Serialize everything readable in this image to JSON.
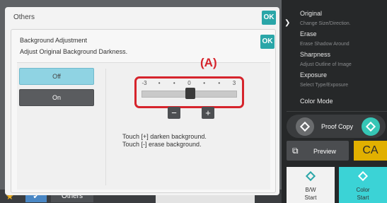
{
  "base": {
    "others_label": "Others"
  },
  "others_dialog": {
    "title": "Others",
    "ok_label": "OK"
  },
  "bg_dialog": {
    "title": "Background Adjustment",
    "subtitle": "Adjust Original Background Darkness.",
    "ok_label": "OK",
    "options": {
      "off": "Off",
      "on": "On",
      "selected": "Off"
    },
    "callout_label": "(A)",
    "slider": {
      "ticks": [
        "-3",
        "•",
        "•",
        "0",
        "•",
        "•",
        "3"
      ],
      "min": -3,
      "max": 3,
      "value": 0
    },
    "minus_label": "−",
    "plus_label": "+",
    "hint_darken": "Touch [+] darken background.",
    "hint_erase": "Touch [-] erase background."
  },
  "side_menu": {
    "items": [
      {
        "head": "Original",
        "sub": "Change Size/Direction."
      },
      {
        "head": "Erase",
        "sub": "Erase Shadow Around"
      },
      {
        "head": "Sharpness",
        "sub": "Adjust Outline of Image"
      },
      {
        "head": "Exposure",
        "sub": "Select Type/Exposure"
      },
      {
        "head": "Color Mode",
        "sub": ""
      }
    ],
    "proof_copy": "Proof Copy",
    "preview": "Preview",
    "ca": "CA",
    "bw_start": [
      "B/W",
      "Start"
    ],
    "color_start": [
      "Color",
      "Start"
    ]
  },
  "colors": {
    "accent_teal": "#2aa6a8",
    "callout_red": "#d6242c",
    "ca_yellow": "#e1b000",
    "color_start": "#3bd3d6"
  }
}
